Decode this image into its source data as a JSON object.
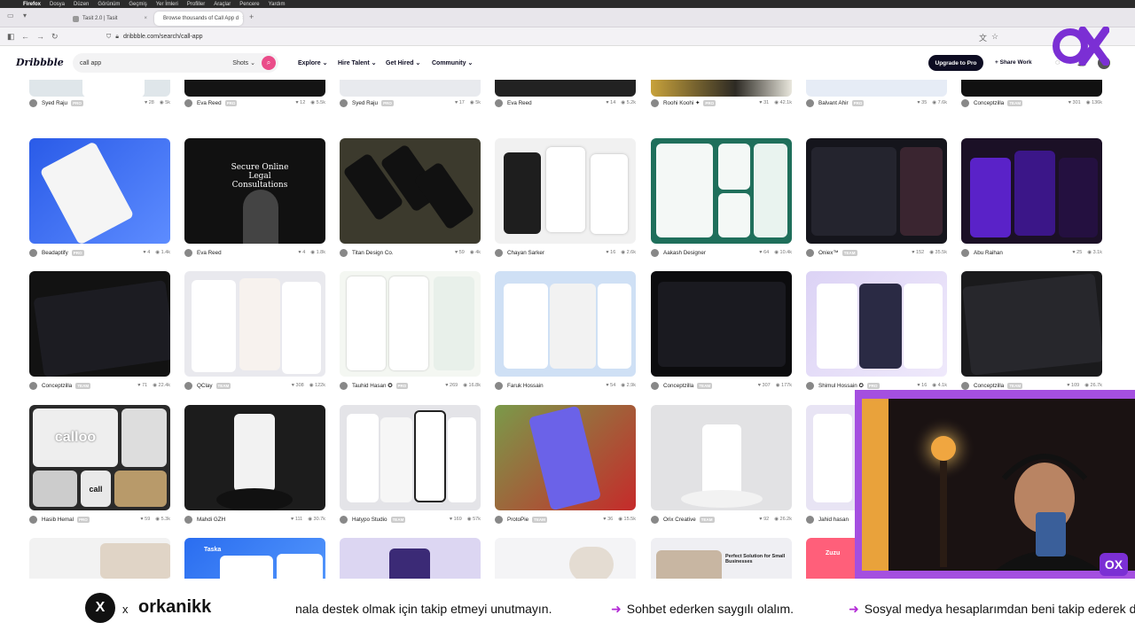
{
  "menubar": [
    "Firefox",
    "Dosya",
    "Düzen",
    "Görünüm",
    "Geçmiş",
    "Yer İmleri",
    "Profiller",
    "Araçlar",
    "Pencere",
    "Yardım"
  ],
  "tabs": [
    {
      "label": "Tasit 2.0 | Tasit",
      "active": false
    },
    {
      "label": "Browse thousands of Call App d",
      "active": true
    }
  ],
  "url": "dribbble.com/search/call-app",
  "header": {
    "logo": "Dribbble",
    "search_value": "call app",
    "search_filter": "Shots",
    "nav": [
      "Explore",
      "Hire Talent",
      "Get Hired",
      "Community"
    ],
    "upgrade": "Upgrade to Pro",
    "share": "Share Work"
  },
  "rows": [
    [
      {
        "author": "Syed Raju",
        "badge": "PRO",
        "likes": "28",
        "views": "5k"
      },
      {
        "author": "Eva Reed",
        "badge": "PRO",
        "likes": "12",
        "views": "5.5k"
      },
      {
        "author": "Syed Raju",
        "badge": "PRO",
        "likes": "17",
        "views": "5k"
      },
      {
        "author": "Eva Reed",
        "badge": "",
        "likes": "14",
        "views": "5.2k"
      },
      {
        "author": "Roohi Koohi ✦",
        "badge": "PRO",
        "likes": "31",
        "views": "42.1k"
      },
      {
        "author": "Balvant Ahir",
        "badge": "PRO",
        "likes": "35",
        "views": "7.6k"
      },
      {
        "author": "Conceptzilla",
        "badge": "TEAM",
        "likes": "301",
        "views": "136k"
      }
    ],
    [
      {
        "author": "Beadaptify",
        "badge": "PRO",
        "likes": "4",
        "views": "1.4k"
      },
      {
        "author": "Eva Reed",
        "badge": "",
        "likes": "4",
        "views": "1.8k"
      },
      {
        "author": "Titan Design Co.",
        "badge": "",
        "likes": "59",
        "views": "4k"
      },
      {
        "author": "Chayan Sarker",
        "badge": "",
        "likes": "16",
        "views": "2.6k"
      },
      {
        "author": "Aakash Designer",
        "badge": "",
        "likes": "64",
        "views": "10.4k"
      },
      {
        "author": "Oniex™",
        "badge": "TEAM",
        "likes": "152",
        "views": "35.5k"
      },
      {
        "author": "Abu Raihan",
        "badge": "",
        "likes": "25",
        "views": "3.1k"
      }
    ],
    [
      {
        "author": "Conceptzilla",
        "badge": "TEAM",
        "likes": "71",
        "views": "22.4k"
      },
      {
        "author": "QClay",
        "badge": "TEAM",
        "likes": "308",
        "views": "122k"
      },
      {
        "author": "Tauhid Hasan ✪",
        "badge": "PRO",
        "likes": "269",
        "views": "16.8k"
      },
      {
        "author": "Faruk Hossain",
        "badge": "",
        "likes": "54",
        "views": "2.9k"
      },
      {
        "author": "Conceptzilla",
        "badge": "TEAM",
        "likes": "307",
        "views": "177k"
      },
      {
        "author": "Shimul Hossain ✪",
        "badge": "PRO",
        "likes": "16",
        "views": "4.1k"
      },
      {
        "author": "Conceptzilla",
        "badge": "TEAM",
        "likes": "109",
        "views": "26.7k"
      }
    ],
    [
      {
        "author": "Hasib Hemal",
        "badge": "PRO",
        "likes": "59",
        "views": "5.3k"
      },
      {
        "author": "Mahdi GZH",
        "badge": "",
        "likes": "111",
        "views": "30.7k"
      },
      {
        "author": "Hatypo Studio",
        "badge": "TEAM",
        "likes": "169",
        "views": "57k"
      },
      {
        "author": "ProtoPie",
        "badge": "TEAM",
        "likes": "36",
        "views": "15.5k"
      },
      {
        "author": "Orix Creative",
        "badge": "TEAM",
        "likes": "92",
        "views": "26.2k"
      },
      {
        "author": "Jahid hasan",
        "badge": "",
        "likes": "",
        "views": ""
      },
      {
        "author": "",
        "badge": "",
        "likes": "",
        "views": ""
      }
    ]
  ],
  "thumb_text": {
    "legal": "Secure Online Legal Consultations",
    "calloo": "calloo",
    "call": "call",
    "taska": "Taska",
    "perfect": "Perfect Solution for Small Businesses",
    "zuzu": "Zuzu"
  },
  "colors": {
    "accent": "#ea4c89",
    "ticker_arrow": "#b32ad6",
    "webcam_border": "#a44fe0"
  },
  "overlay": {
    "x_logo": "X",
    "x_sep": "x",
    "handle": "orkanikk",
    "ticker": [
      "nala destek olmak için takip etmeyi unutmayın.",
      "Sohbet ederken saygılı olalım.",
      "Sosyal medya hesaplarımdan beni takip ederek d"
    ],
    "badge": "OX"
  }
}
